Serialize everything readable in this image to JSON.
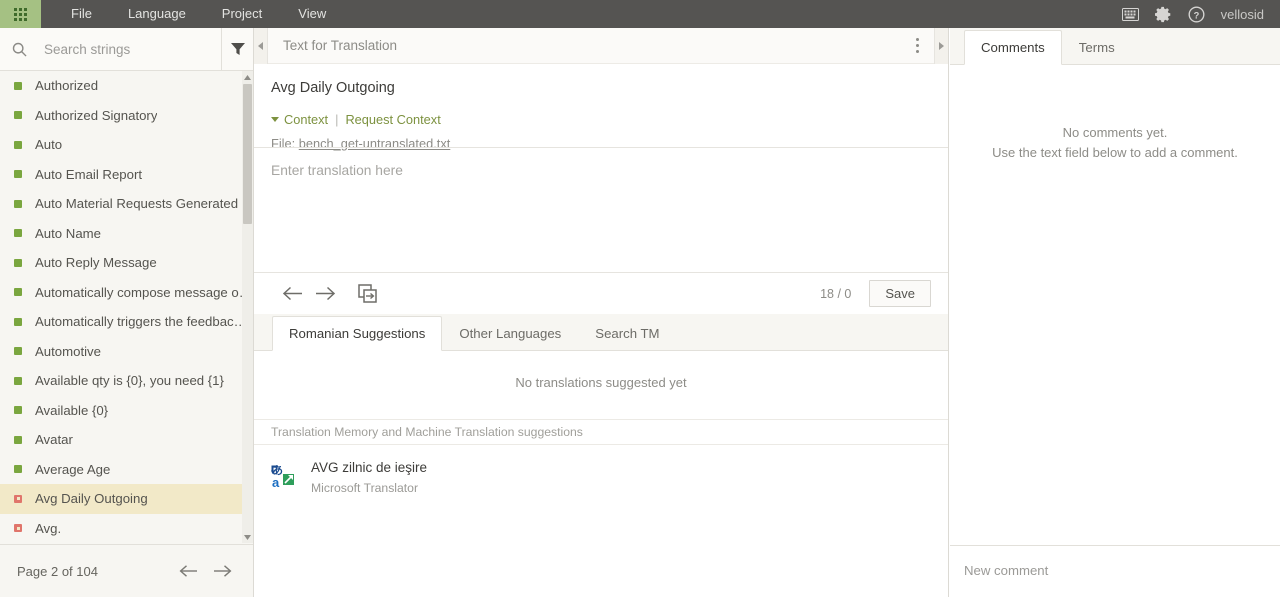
{
  "topbar": {
    "logo_icon": "app-grid-icon",
    "menu": [
      {
        "label": "File"
      },
      {
        "label": "Language"
      },
      {
        "label": "Project"
      },
      {
        "label": "View"
      }
    ],
    "right_icons": [
      {
        "name": "keyboard-icon"
      },
      {
        "name": "gear-icon"
      },
      {
        "name": "help-icon"
      }
    ],
    "username": "vellosid"
  },
  "sidebar": {
    "search": {
      "placeholder": "Search strings",
      "value": ""
    },
    "filter_icon": "filter-funnel-icon",
    "items": [
      {
        "label": "Authorized",
        "status": "green"
      },
      {
        "label": "Authorized Signatory",
        "status": "green"
      },
      {
        "label": "Auto",
        "status": "green"
      },
      {
        "label": "Auto Email Report",
        "status": "green"
      },
      {
        "label": "Auto Material Requests Generated",
        "status": "green"
      },
      {
        "label": "Auto Name",
        "status": "green"
      },
      {
        "label": "Auto Reply Message",
        "status": "green"
      },
      {
        "label": "Automatically compose message on ...",
        "status": "green"
      },
      {
        "label": "Automatically triggers the feedback ...",
        "status": "green"
      },
      {
        "label": "Automotive",
        "status": "green"
      },
      {
        "label": "Available qty is {0}, you need {1}",
        "status": "green"
      },
      {
        "label": "Available {0}",
        "status": "green"
      },
      {
        "label": "Avatar",
        "status": "green"
      },
      {
        "label": "Average Age",
        "status": "green"
      },
      {
        "label": "Avg Daily Outgoing",
        "status": "red",
        "selected": true
      },
      {
        "label": "Avg.",
        "status": "red"
      }
    ],
    "pager": {
      "label": "Page 2 of 104",
      "prev_icon": "arrow-left-icon",
      "next_icon": "arrow-right-icon"
    }
  },
  "editor": {
    "collapse_left_icon": "chevron-left-icon",
    "collapse_right_icon": "chevron-right-icon",
    "title": "Text for Translation",
    "kebab_icon": "more-options-icon",
    "source_text": "Avg Daily Outgoing",
    "context_toggle_label": "Context",
    "context_separator": "|",
    "request_context_label": "Request Context",
    "file_prefix": "File:",
    "file_name": "bench_get-untranslated.txt",
    "target": {
      "placeholder": "Enter translation here",
      "value": ""
    },
    "toolbar": {
      "prev_icon": "arrow-left-icon",
      "next_icon": "arrow-right-icon",
      "copy_source_icon": "copy-source-icon",
      "char_count": "18 / 0",
      "save_label": "Save"
    },
    "suggestion_tabs": [
      {
        "label": "Romanian Suggestions",
        "active": true
      },
      {
        "label": "Other Languages",
        "active": false
      },
      {
        "label": "Search TM",
        "active": false
      }
    ],
    "no_suggestions_text": "No translations suggested yet",
    "tm_header": "Translation Memory and Machine Translation suggestions",
    "tm_results": [
      {
        "icon": "microsoft-translator-icon",
        "text": "AVG zilnic de ieşire",
        "provider": "Microsoft Translator"
      }
    ]
  },
  "right_panel": {
    "tabs": [
      {
        "label": "Comments",
        "active": true
      },
      {
        "label": "Terms",
        "active": false
      }
    ],
    "empty_line1": "No comments yet.",
    "empty_line2": "Use the text field below to add a comment.",
    "new_comment": {
      "placeholder": "New comment",
      "value": ""
    }
  },
  "colors": {
    "topbar_bg": "#555452",
    "logo_bg": "#a5c183",
    "sidebar_bg": "#f7f6f2",
    "selected_row": "#f2e9c8",
    "status_green": "#7aa63f",
    "status_red": "#e0756b",
    "link_olive": "#7d9240"
  }
}
